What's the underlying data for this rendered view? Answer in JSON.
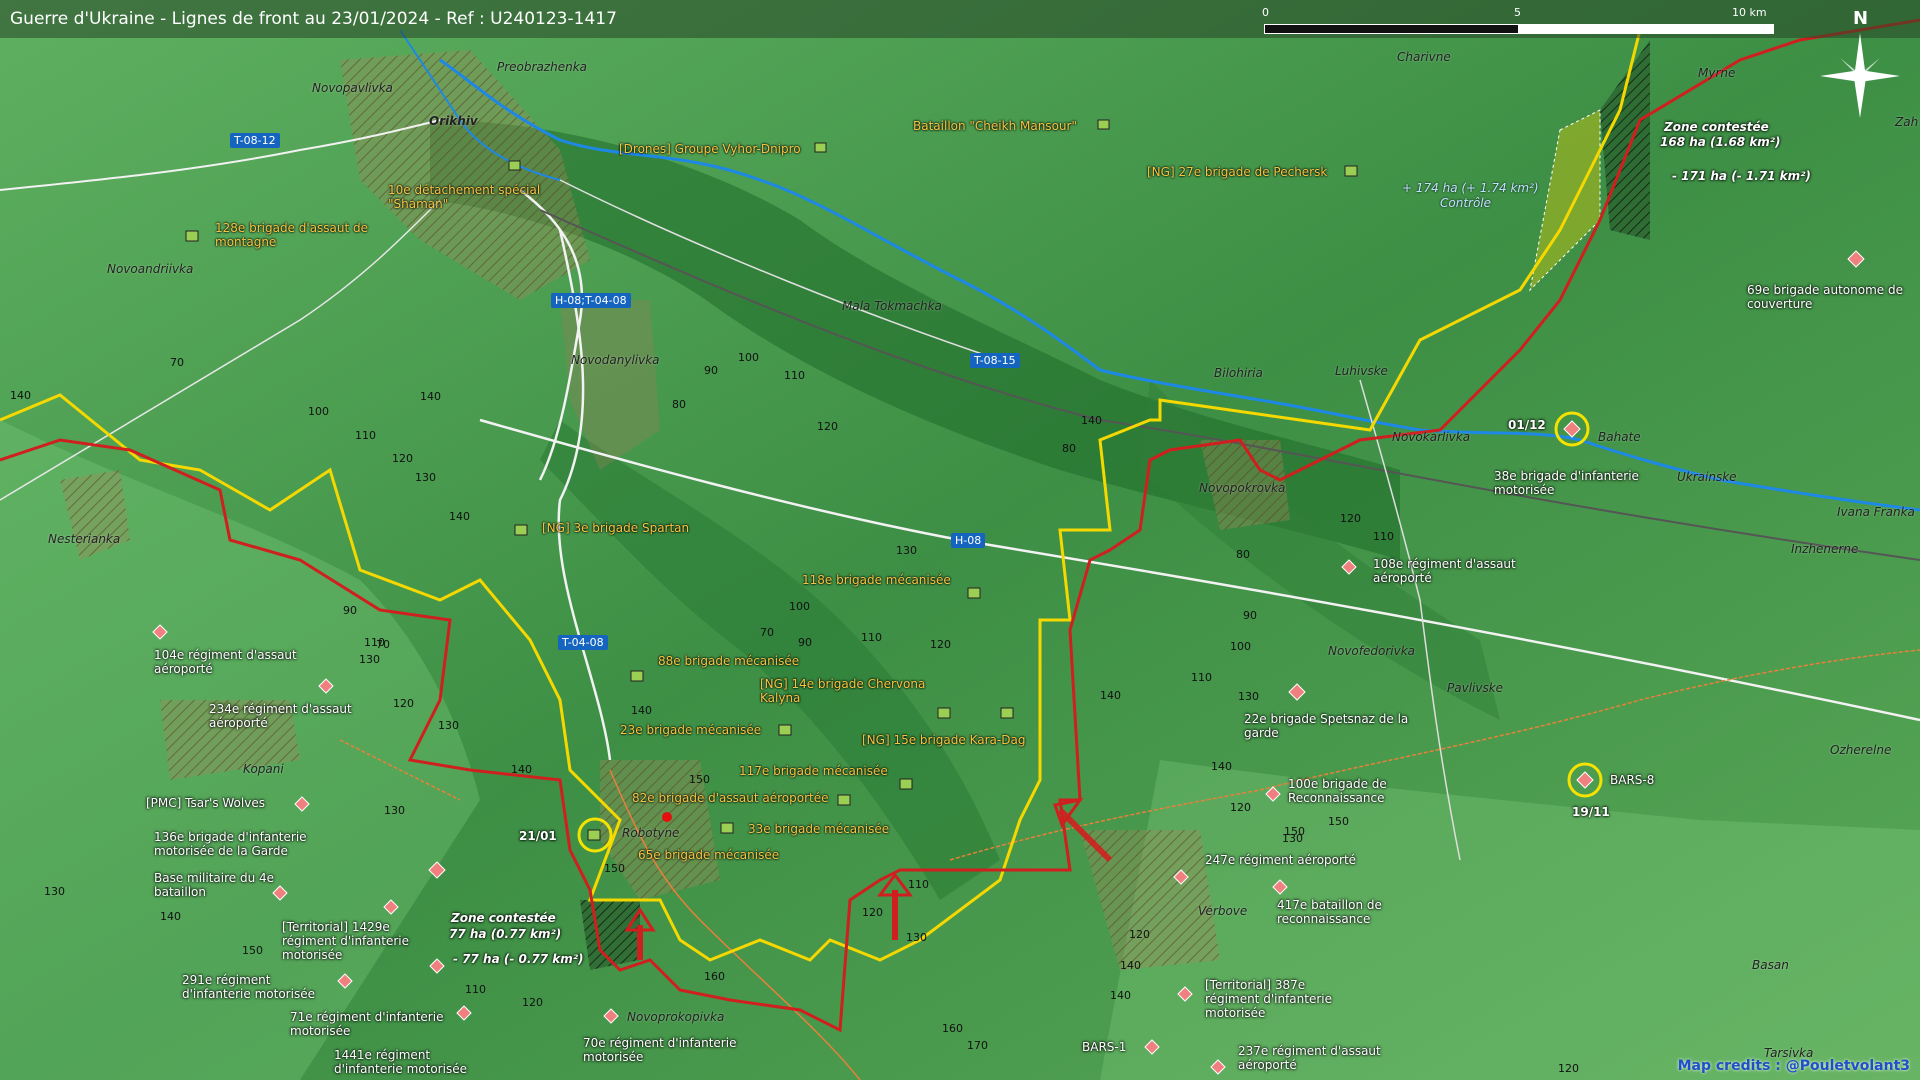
{
  "title": "Guerre d'Ukraine - Lignes de front au 23/01/2024 - Ref : U240123-1417",
  "scale": {
    "labels": [
      "0",
      "5",
      "10 km"
    ]
  },
  "compass": {
    "label": "N",
    "icon": "compass-rose-icon"
  },
  "credits": "Map credits : @Pouletvolant3",
  "colors": {
    "ukraine_line": "#f5d800",
    "russia_line": "#d01f1f",
    "river": "#1e88e5",
    "terrain_low": "#1f6b2a",
    "terrain_high": "#8fd08a"
  },
  "roads": [
    "T-08-12",
    "H-08;T-04-08",
    "T-08-15",
    "H-08",
    "T-04-08"
  ],
  "places": [
    "Preobrazhenka",
    "Novopavlivka",
    "Orikhiv",
    "Novoandriivka",
    "Novodanylivka",
    "Mala Tokmachka",
    "Charivne",
    "Myrne",
    "Zah",
    "Bilohiria",
    "Luhivske",
    "Novokarlivka",
    "Bahate",
    "Ukrainske",
    "Ivana Franka",
    "Inzhenerne",
    "Novopokrovka",
    "Nesterianka",
    "Novofedorivka",
    "Pavlivske",
    "Ozherelne",
    "Kopani",
    "Robotyne",
    "Verbove",
    "Novoprokopivka",
    "Basan",
    "Tarsivka"
  ],
  "ukrainian_units": [
    "[Drones] Groupe Vyhor-Dnipro",
    "Bataillon \"Cheikh Mansour\"",
    "[NG] 27e brigade de Pechersk",
    "10e détachement spécial \"Shaman\"",
    "128e brigade d'assaut de montagne",
    "[NG] 3e brigade Spartan",
    "118e brigade mécanisée",
    "88e brigade mécanisée",
    "[NG] 14e brigade Chervona Kalyna",
    "23e brigade mécanisée",
    "[NG] 15e brigade Kara-Dag",
    "117e brigade mécanisée",
    "82e brigade d'assaut aéroportée",
    "33e brigade mécanisée",
    "65e brigade mécanisée"
  ],
  "russian_units": [
    "69e brigade autonome de couverture",
    "38e brigade d'infanterie motorisée",
    "108e régiment d'assaut aéroporté",
    "104e régiment d'assaut aéroporté",
    "234e régiment d'assaut aéroporté",
    "22e brigade Spetsnaz de la garde",
    "BARS-8",
    "100e brigade de Reconnaissance",
    "[PMC] Tsar's Wolves",
    "136e brigade d'infanterie motorisée de la Garde",
    "Base militaire du 4e bataillon",
    "247e régiment aéroporté",
    "417e bataillon de reconnaissance",
    "[Territorial] 1429e régiment d'infanterie motorisée",
    "291e régiment d'infanterie motorisée",
    "71e régiment d'infanterie motorisée",
    "1441e régiment d'infanterie motorisée",
    "70e régiment d'infanterie motorisée",
    "[Territorial] 387e régiment d'infanterie motorisée",
    "BARS-1",
    "237e régiment d'assaut aéroporté"
  ],
  "contested": [
    {
      "title": "Zone contestée",
      "area": "168 ha (1.68 km²)",
      "change": "- 171 ha (- 1.71 km²)"
    },
    {
      "title": "Zone contestée",
      "area": "77 ha (0.77 km²)",
      "change": "- 77 ha (- 0.77 km²)"
    }
  ],
  "control_change": {
    "area": "+ 174 ha (+ 1.74 km²)",
    "label": "Contrôle"
  },
  "dates": [
    "01/12",
    "19/11",
    "21/01"
  ],
  "elevations": [
    "140",
    "70",
    "100",
    "110",
    "120",
    "130",
    "140",
    "90",
    "100",
    "110",
    "80",
    "120",
    "140",
    "130",
    "140",
    "90",
    "70",
    "80",
    "120",
    "110",
    "80",
    "100",
    "130",
    "110",
    "70",
    "90",
    "110",
    "120",
    "90",
    "100",
    "130",
    "110",
    "140",
    "120",
    "140",
    "140",
    "150",
    "130",
    "140",
    "150",
    "150",
    "120",
    "130",
    "130",
    "120",
    "140",
    "160",
    "160",
    "170",
    "140",
    "150",
    "150",
    "110",
    "120",
    "130",
    "120",
    "130",
    "110",
    "120",
    "140"
  ]
}
